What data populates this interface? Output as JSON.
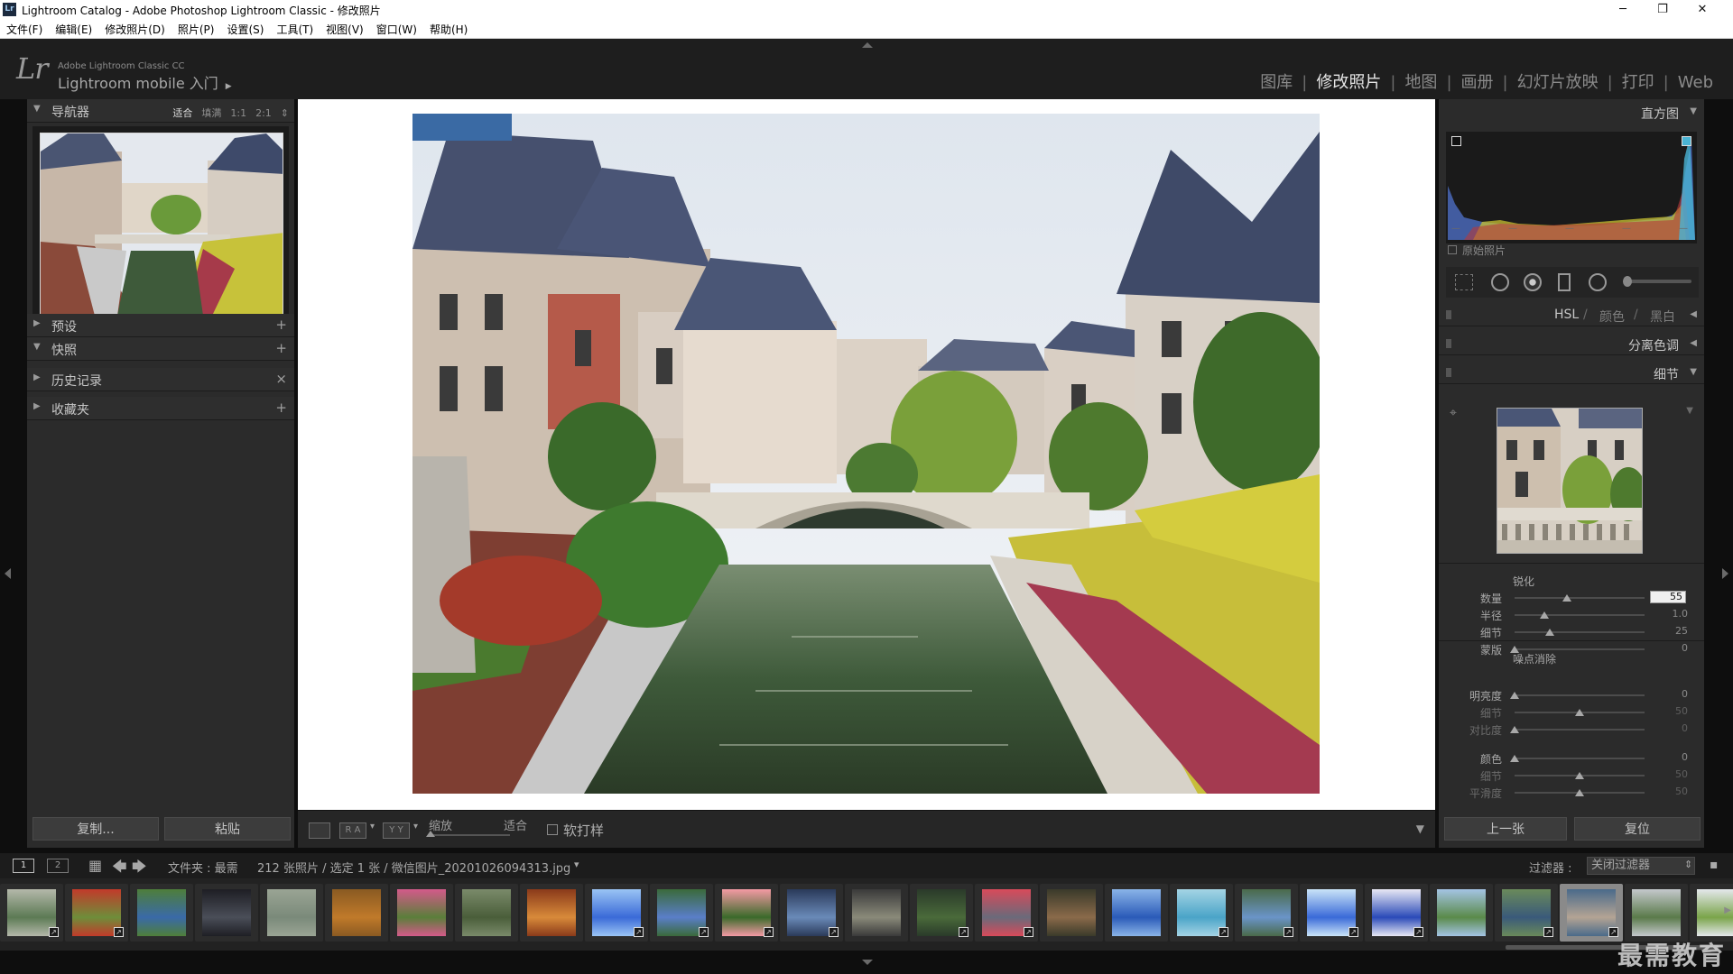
{
  "window": {
    "icon": "Lr",
    "title": "Lightroom Catalog - Adobe Photoshop Lightroom Classic - 修改照片",
    "minimize": "─",
    "maximize": "❐",
    "close": "✕"
  },
  "menu": [
    "文件(F)",
    "编辑(E)",
    "修改照片(D)",
    "照片(P)",
    "设置(S)",
    "工具(T)",
    "视图(V)",
    "窗口(W)",
    "帮助(H)"
  ],
  "identity": {
    "logo": "Lr",
    "product": "Adobe Lightroom Classic CC",
    "mobile": "Lightroom mobile 入门",
    "mobile_arrow": "▶"
  },
  "modules": [
    "图库",
    "修改照片",
    "地图",
    "画册",
    "幻灯片放映",
    "打印",
    "Web"
  ],
  "module_sep": "|",
  "active_module": "修改照片",
  "navigator": {
    "title": "导航器",
    "zoom": [
      "适合",
      "填满",
      "1:1",
      "2:1"
    ],
    "zoom_arrow": "⇕",
    "active_zoom": "适合"
  },
  "left_panels": [
    {
      "label": "预设",
      "action": "+",
      "state": "▶"
    },
    {
      "label": "快照",
      "action": "+",
      "state": "▼"
    },
    {
      "label": "历史记录",
      "action": "×",
      "state": "▶"
    },
    {
      "label": "收藏夹",
      "action": "+",
      "state": "▶"
    }
  ],
  "left_buttons": {
    "copy": "复制...",
    "paste": "粘贴"
  },
  "toolbar": {
    "view_a": "R A",
    "view_b": "Y Y",
    "zoom_label": "缩放",
    "zoom_value": "适合",
    "softproof": "软打样",
    "menu_arrow": "▾",
    "collapse_arrow": "▼"
  },
  "histogram": {
    "title": "直方图",
    "original_photo": "原始照片",
    "ticks": [
      "—",
      "—",
      "—",
      "—",
      "—"
    ]
  },
  "right_panels": {
    "hsl": "HSL",
    "color": "颜色",
    "bw": "黑白",
    "sep": "/",
    "split_toning": "分离色调",
    "detail": "细节"
  },
  "sharpening": {
    "title": "锐化",
    "sliders": [
      {
        "label": "数量",
        "value": "55",
        "pos": 0.4
      },
      {
        "label": "半径",
        "value": "1.0",
        "pos": 0.23
      },
      {
        "label": "细节",
        "value": "25",
        "pos": 0.27
      },
      {
        "label": "蒙版",
        "value": "0",
        "pos": 0.0
      }
    ]
  },
  "noise": {
    "title": "噪点消除",
    "luminance": [
      {
        "label": "明亮度",
        "value": "0",
        "pos": 0.0,
        "dim": false
      },
      {
        "label": "细节",
        "value": "50",
        "pos": 0.5,
        "dim": true
      },
      {
        "label": "对比度",
        "value": "0",
        "pos": 0.0,
        "dim": true
      }
    ],
    "color": [
      {
        "label": "颜色",
        "value": "0",
        "pos": 0.0,
        "dim": false
      },
      {
        "label": "细节",
        "value": "50",
        "pos": 0.5,
        "dim": true
      },
      {
        "label": "平滑度",
        "value": "50",
        "pos": 0.5,
        "dim": true
      }
    ]
  },
  "right_buttons": {
    "prev": "上一张",
    "reset": "复位"
  },
  "filmbar": {
    "page1": "1",
    "page2": "2",
    "grid_icon": "▦",
    "back": "🡄",
    "forward": "🡆",
    "folder_text": "文件夹 : 最需",
    "count_text": "212 张照片 / 选定 1 张 / 微信图片_20201026094313.jpg",
    "file_arrow": "▾",
    "filter_label": "过滤器 :",
    "filter_value": "关闭过滤器",
    "filter_arrow": "⇕",
    "lock": "▪"
  },
  "filmstrip_nav": {
    "left": "◀",
    "right": "▶"
  },
  "filmstrip_badge": "↗",
  "filmstrip_colors": [
    [
      "#5c7a54",
      "#b4b8aa"
    ],
    [
      "#6e8e3a",
      "#c23a2a"
    ],
    [
      "#3a6aa8",
      "#4e7e3a"
    ],
    [
      "#4a4e58",
      "#1e1e24"
    ],
    [
      "#7a8a7a",
      "#9aa494"
    ],
    [
      "#c07a2a",
      "#8a5a22"
    ],
    [
      "#5a7e3a",
      "#d45a8a"
    ],
    [
      "#4a5e3a",
      "#7a8a6a"
    ],
    [
      "#d88a3a",
      "#8a3a1a"
    ],
    [
      "#3a6ad8",
      "#9ac4f4"
    ],
    [
      "#5a7ec8",
      "#3a6a3a"
    ],
    [
      "#3a6a2a",
      "#f49aa4"
    ],
    [
      "#6a8ab8",
      "#2a3a5a"
    ],
    [
      "#8a8a7a",
      "#3a3a3a"
    ],
    [
      "#4a6a3a",
      "#2a3a2a"
    ],
    [
      "#6a6a7a",
      "#d84a5a"
    ],
    [
      "#8a6a4a",
      "#3a3a2a"
    ],
    [
      "#2a5ab8",
      "#8ab4e8"
    ],
    [
      "#4aa4c8",
      "#a4d4e4"
    ],
    [
      "#6a94c8",
      "#4a6a4a"
    ],
    [
      "#3a6ad8",
      "#cae4f8"
    ],
    [
      "#2a4ab8",
      "#e8e8f4"
    ],
    [
      "#5a8a4a",
      "#a4c4e4"
    ],
    [
      "#3a5a7a",
      "#6a8a5a"
    ],
    [
      "#b4a494",
      "#4a6a8a"
    ],
    [
      "#5a7a4a",
      "#c4c8cc"
    ],
    [
      "#7aa44a",
      "#e4e8ec"
    ]
  ],
  "watermark": "最需教育"
}
